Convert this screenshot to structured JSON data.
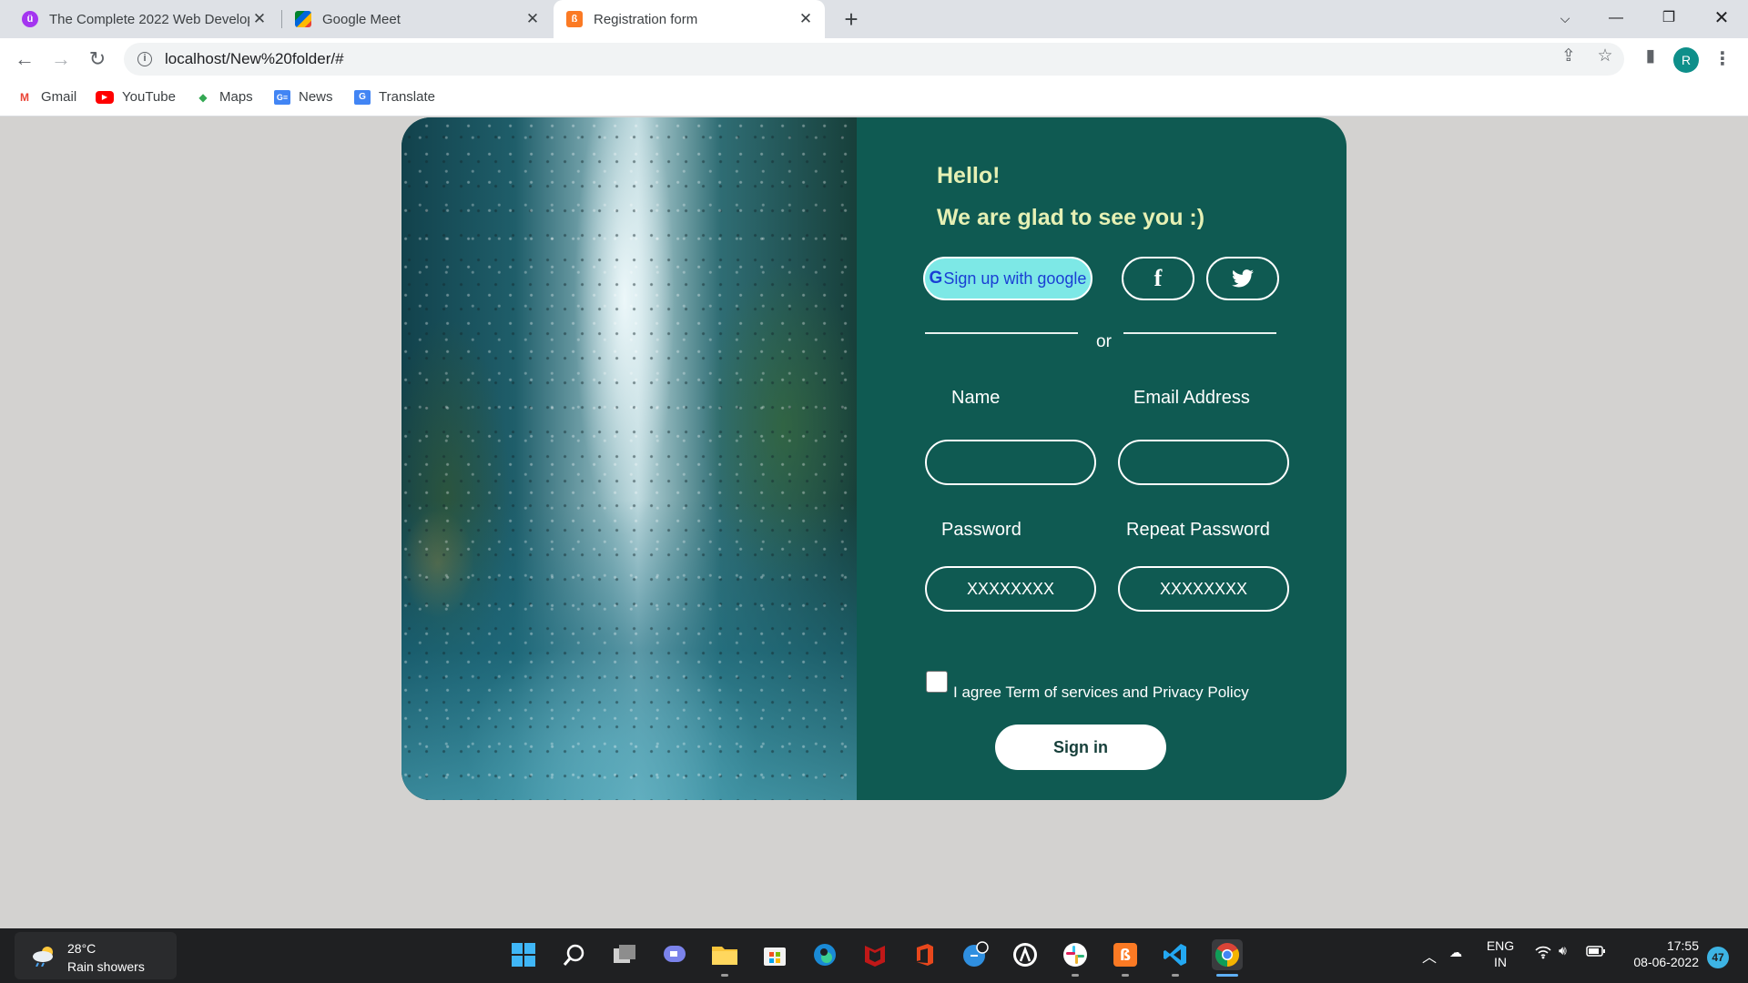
{
  "browser": {
    "tabs": [
      {
        "title": "The Complete 2022 Web Develop",
        "active": false,
        "favicon": "udemy-icon"
      },
      {
        "title": "Google Meet",
        "active": false,
        "favicon": "google-meet-icon"
      },
      {
        "title": "Registration form",
        "active": true,
        "favicon": "xampp-icon"
      }
    ],
    "url": "localhost/New%20folder/#",
    "profile_initial": "R",
    "bookmarks": [
      {
        "label": "Gmail",
        "icon": "gmail-icon"
      },
      {
        "label": "YouTube",
        "icon": "youtube-icon"
      },
      {
        "label": "Maps",
        "icon": "maps-icon"
      },
      {
        "label": "News",
        "icon": "news-icon"
      },
      {
        "label": "Translate",
        "icon": "translate-icon"
      }
    ]
  },
  "form": {
    "greeting_line1": "Hello!",
    "greeting_line2": "We are glad to see you :)",
    "google_g": "G",
    "google_label": "Sign up with google",
    "facebook_icon": "facebook-icon",
    "twitter_icon": "twitter-icon",
    "or_text": "or",
    "name_label": "Name",
    "email_label": "Email Address",
    "password_label": "Password",
    "repeat_password_label": "Repeat Password",
    "password_placeholder": "XXXXXXXX",
    "repeat_password_placeholder": "XXXXXXXX",
    "agree_text": "I agree Term of services and Privacy Policy",
    "signin_label": "Sign in",
    "colors": {
      "panel": "#0f5a52",
      "greeting": "#e6f0b4",
      "google_button": "#7de8e6"
    }
  },
  "taskbar": {
    "weather_temp": "28°C",
    "weather_desc": "Rain showers",
    "language_line1": "ENG",
    "language_line2": "IN",
    "time": "17:55",
    "date": "08-06-2022",
    "notification_count": "47",
    "apps": [
      "start-icon",
      "search-icon",
      "task-view-icon",
      "teams-chat-icon",
      "file-explorer-icon",
      "microsoft-store-icon",
      "edge-icon",
      "mcafee-icon",
      "office-icon",
      "feedback-icon",
      "lens-icon",
      "slack-icon",
      "xampp-icon",
      "vscode-icon",
      "chrome-icon"
    ]
  }
}
